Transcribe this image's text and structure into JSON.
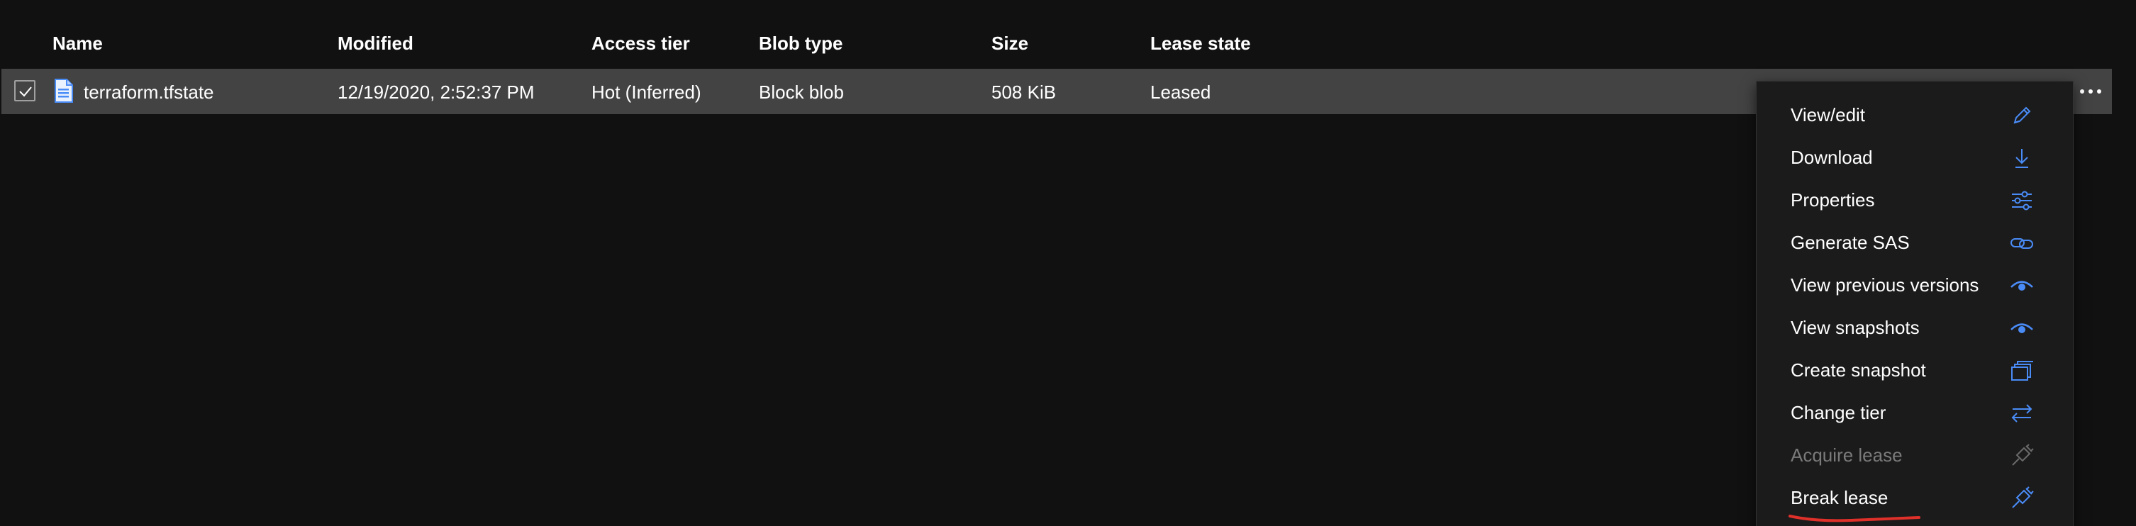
{
  "table": {
    "columns": [
      "Name",
      "Modified",
      "Access tier",
      "Blob type",
      "Size",
      "Lease state"
    ],
    "rows": [
      {
        "selected": true,
        "name": "terraform.tfstate",
        "modified": "12/19/2020, 2:52:37 PM",
        "access_tier": "Hot (Inferred)",
        "blob_type": "Block blob",
        "size": "508 KiB",
        "lease_state": "Leased"
      }
    ]
  },
  "context_menu": {
    "items": [
      {
        "label": "View/edit",
        "icon": "pencil-icon",
        "enabled": true
      },
      {
        "label": "Download",
        "icon": "download-icon",
        "enabled": true
      },
      {
        "label": "Properties",
        "icon": "properties-sliders-icon",
        "enabled": true
      },
      {
        "label": "Generate SAS",
        "icon": "link-icon",
        "enabled": true
      },
      {
        "label": "View previous versions",
        "icon": "eye-icon",
        "enabled": true
      },
      {
        "label": "View snapshots",
        "icon": "eye-icon",
        "enabled": true
      },
      {
        "label": "Create snapshot",
        "icon": "snapshot-stack-icon",
        "enabled": true
      },
      {
        "label": "Change tier",
        "icon": "swap-arrows-icon",
        "enabled": true
      },
      {
        "label": "Acquire lease",
        "icon": "plug-icon",
        "enabled": false
      },
      {
        "label": "Break lease",
        "icon": "plug-icon",
        "enabled": true
      }
    ]
  },
  "colors": {
    "background": "#111111",
    "selected_row": "#434343",
    "menu_background": "#1b1b1b",
    "icon_accent": "#4a8cf7",
    "disabled_text": "#7a7a7a",
    "annotation_red": "#e0302a"
  }
}
